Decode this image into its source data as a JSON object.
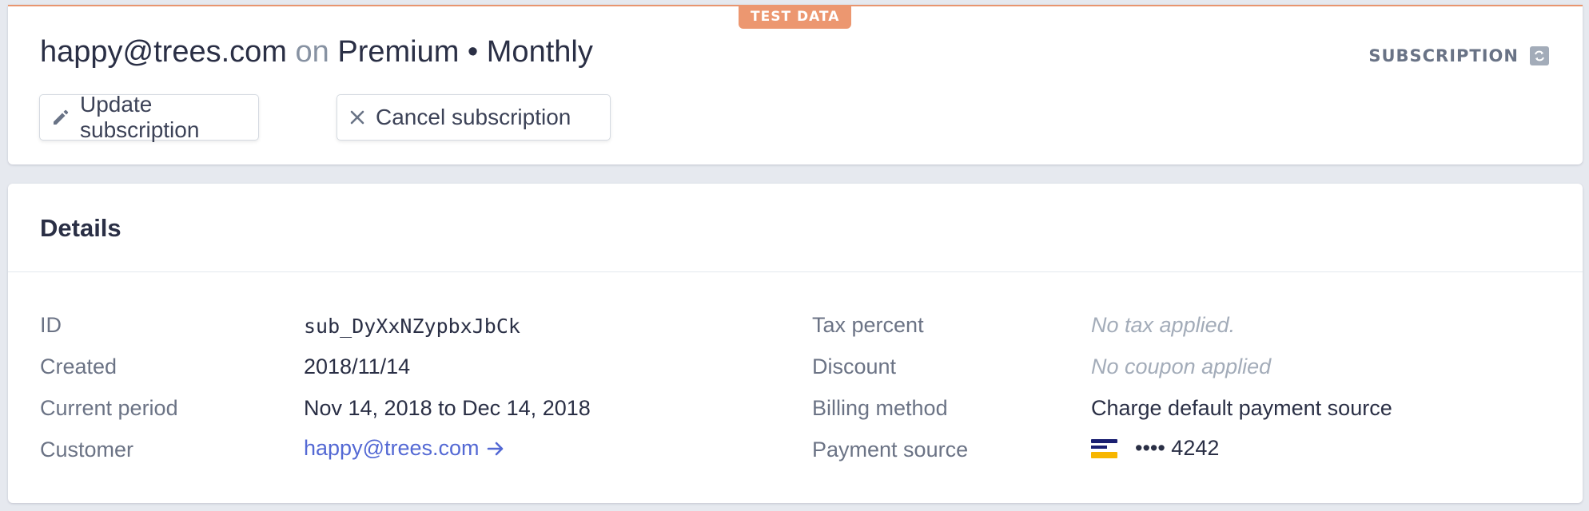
{
  "badge": "TEST DATA",
  "header": {
    "email": "happy@trees.com",
    "connector": "on",
    "plan": "Premium • Monthly",
    "type_label": "SUBSCRIPTION",
    "type_icon": "subscription-cycle-icon"
  },
  "actions": {
    "update_label": "Update subscription",
    "update_icon": "pencil-icon",
    "cancel_label": "Cancel subscription",
    "cancel_icon": "close-icon"
  },
  "details": {
    "title": "Details",
    "left": [
      {
        "label": "ID",
        "value": "sub_DyXxNZypbxJbCk"
      },
      {
        "label": "Created",
        "value": "2018/11/14"
      },
      {
        "label": "Current period",
        "value": "Nov 14, 2018 to Dec 14, 2018"
      },
      {
        "label": "Customer",
        "value": "happy@trees.com",
        "link_icon": "arrow-right-icon"
      }
    ],
    "right": [
      {
        "label": "Tax percent",
        "value": "No tax applied."
      },
      {
        "label": "Discount",
        "value": "No coupon applied"
      },
      {
        "label": "Billing method",
        "value": "Charge default payment source"
      },
      {
        "label": "Payment source",
        "value": "•••• 4242",
        "icon": "card-brand-icon"
      }
    ]
  },
  "colors": {
    "badge": "#ec9770",
    "link": "#5469d4",
    "text": "#2a2f45",
    "muted": "#6b7385"
  }
}
